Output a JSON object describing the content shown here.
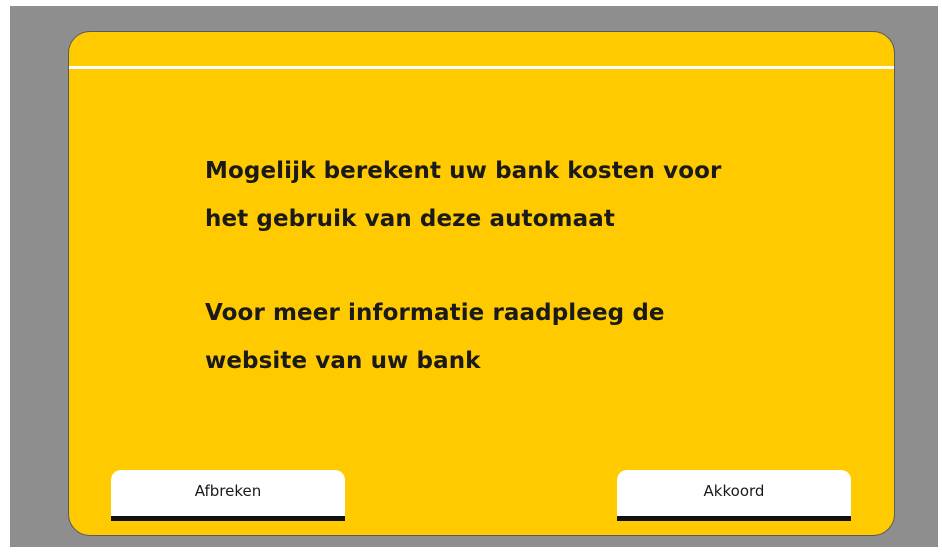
{
  "notice": {
    "line_1": "Mogelijk berekent uw bank kosten voor",
    "line_2": "het gebruik van deze automaat",
    "line_3": "Voor meer informatie raadpleeg de",
    "line_4": "website van uw bank"
  },
  "buttons": {
    "cancel_label": "Afbreken",
    "accept_label": "Akkoord"
  },
  "colors": {
    "screen_background": "#ffca00",
    "bezel": "#8e8e8e",
    "button_background": "#ffffff",
    "button_bar": "#111111"
  }
}
